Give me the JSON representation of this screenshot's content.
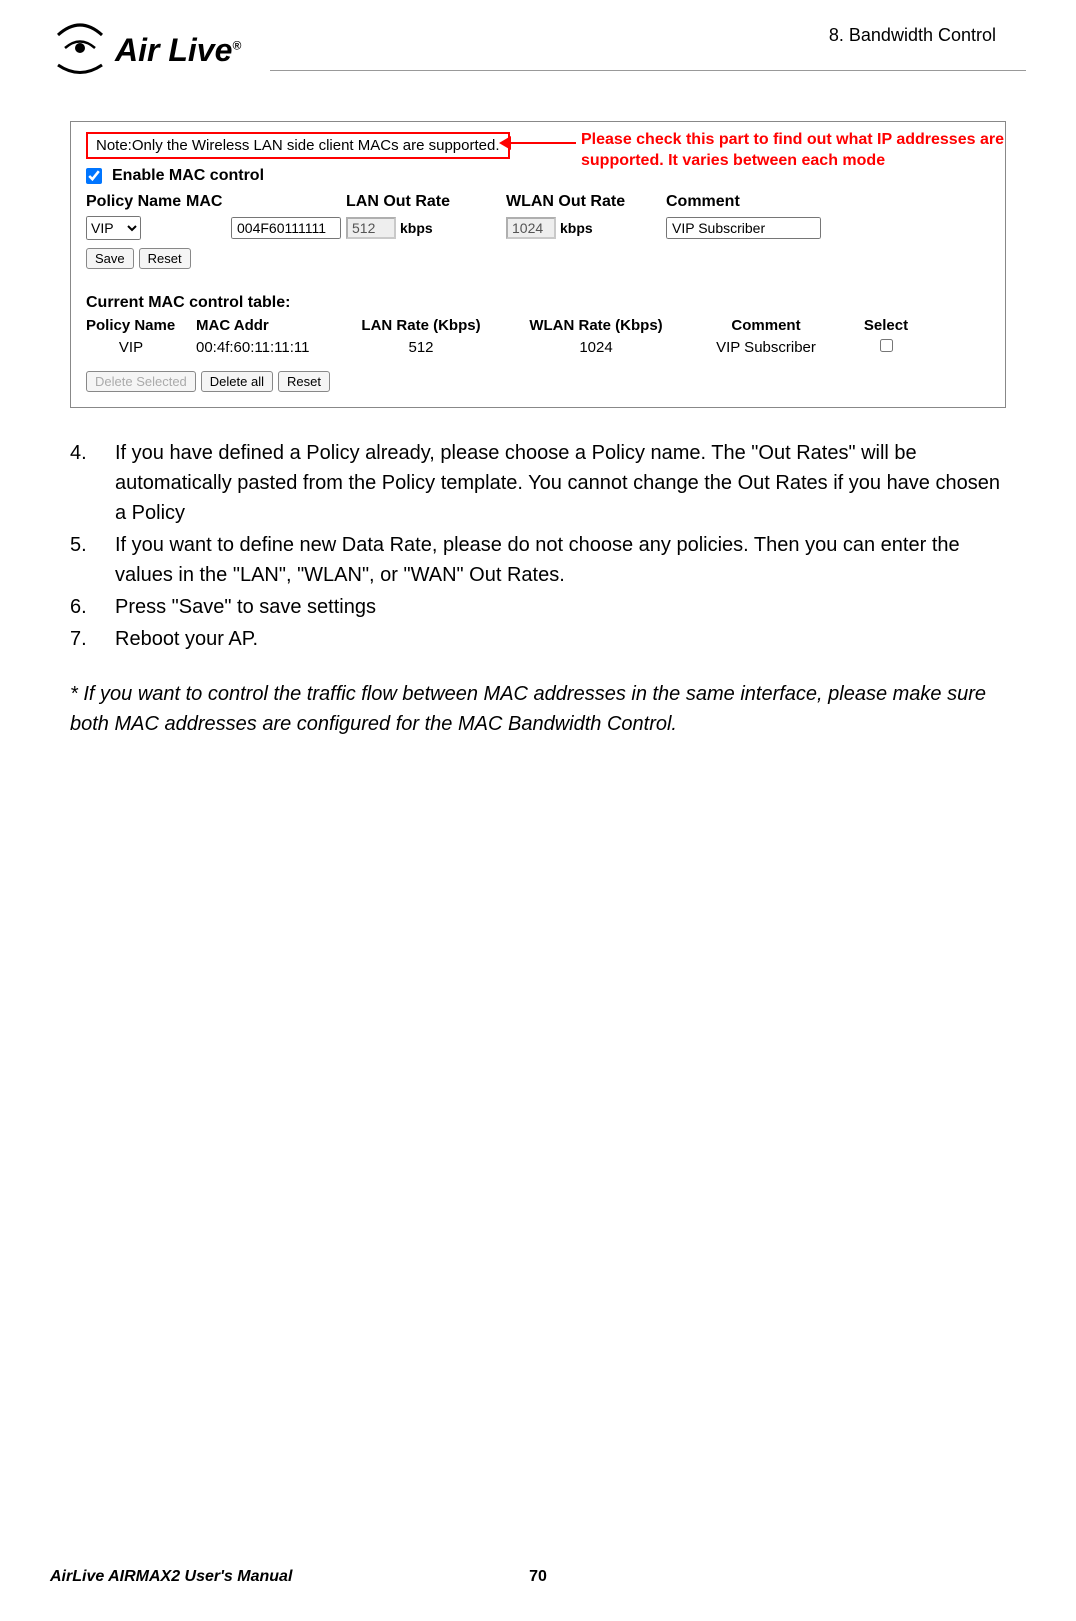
{
  "header": {
    "chapter": "8. Bandwidth Control",
    "logo_text": "Air Live"
  },
  "panel": {
    "note": "Note:Only the Wireless LAN side client MACs are supported.",
    "callout": "Please check this part to find out what IP addresses are supported.   It varies between each mode",
    "enable_label": "Enable MAC control",
    "headers": {
      "policy": "Policy Name",
      "mac": "MAC",
      "lan": "LAN Out Rate",
      "wlan": "WLAN Out Rate",
      "comment": "Comment"
    },
    "form": {
      "policy_value": "VIP",
      "mac_value": "004F60111111",
      "lan_value": "512",
      "wlan_value": "1024",
      "kbps": "kbps",
      "comment_value": "VIP Subscriber"
    },
    "buttons": {
      "save": "Save",
      "reset": "Reset",
      "delete_selected": "Delete Selected",
      "delete_all": "Delete all"
    },
    "table_title": "Current MAC control table:",
    "table_headers": {
      "policy": "Policy Name",
      "mac": "MAC Addr",
      "lan": "LAN Rate (Kbps)",
      "wlan": "WLAN Rate (Kbps)",
      "comment": "Comment",
      "select": "Select"
    },
    "table_rows": [
      {
        "policy": "VIP",
        "mac": "00:4f:60:11:11:11",
        "lan": "512",
        "wlan": "1024",
        "comment": "VIP Subscriber"
      }
    ]
  },
  "body": {
    "items": [
      {
        "num": "4.",
        "text": "If you have defined a Policy already, please choose a Policy name. The \"Out Rates\" will be automatically pasted from the Policy template. You cannot change the Out Rates if you have chosen a Policy"
      },
      {
        "num": "5.",
        "text": "If you want to define new Data Rate, please do not choose any policies. Then you can enter the values in the \"LAN\", \"WLAN\", or \"WAN\" Out Rates."
      },
      {
        "num": "6.",
        "text": "Press \"Save\" to save settings"
      },
      {
        "num": "7.",
        "text": "Reboot your AP."
      }
    ],
    "note": "* If you want to control the traffic flow between MAC addresses in the same interface, please make sure both MAC addresses are configured for the MAC Bandwidth Control."
  },
  "footer": {
    "title": "AirLive AIRMAX2 User's Manual",
    "page": "70"
  }
}
